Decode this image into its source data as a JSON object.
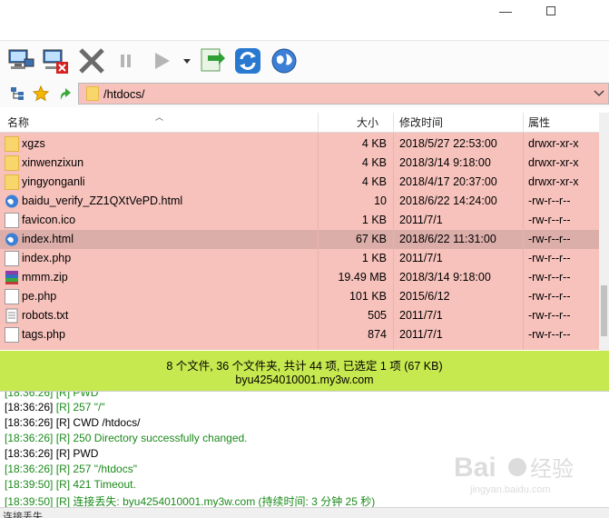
{
  "window": {
    "minimize": "—",
    "maximize": ""
  },
  "path": {
    "value": "/htdocs/"
  },
  "columns": {
    "name": "名称",
    "size": "大小",
    "modified": "修改时间",
    "attr": "属性"
  },
  "files": [
    {
      "name": "xgzs",
      "size": "4 KB",
      "modified": "2018/5/27 22:53:00",
      "attr": "drwxr-xr-x",
      "icon": "folder-icon"
    },
    {
      "name": "xinwenzixun",
      "size": "4 KB",
      "modified": "2018/3/14 9:18:00",
      "attr": "drwxr-xr-x",
      "icon": "folder-icon"
    },
    {
      "name": "yingyonganli",
      "size": "4 KB",
      "modified": "2018/4/17 20:37:00",
      "attr": "drwxr-xr-x",
      "icon": "folder-icon"
    },
    {
      "name": "baidu_verify_ZZ1QXtVePD.html",
      "size": "10",
      "modified": "2018/6/22 14:24:00",
      "attr": "-rw-r--r--",
      "icon": "html-file-icon"
    },
    {
      "name": "favicon.ico",
      "size": "1 KB",
      "modified": "2011/7/1",
      "attr": "-rw-r--r--",
      "icon": "file-icon"
    },
    {
      "name": "index.html",
      "size": "67 KB",
      "modified": "2018/6/22 11:31:00",
      "attr": "-rw-r--r--",
      "icon": "html-file-icon"
    },
    {
      "name": "index.php",
      "size": "1 KB",
      "modified": "2011/7/1",
      "attr": "-rw-r--r--",
      "icon": "file-icon"
    },
    {
      "name": "mmm.zip",
      "size": "19.49 MB",
      "modified": "2018/3/14 9:18:00",
      "attr": "-rw-r--r--",
      "icon": "zip-file-icon"
    },
    {
      "name": "pe.php",
      "size": "101 KB",
      "modified": "2015/6/12",
      "attr": "-rw-r--r--",
      "icon": "file-icon"
    },
    {
      "name": "robots.txt",
      "size": "505",
      "modified": "2011/7/1",
      "attr": "-rw-r--r--",
      "icon": "text-file-icon"
    },
    {
      "name": "tags.php",
      "size": "874",
      "modified": "2011/7/1",
      "attr": "-rw-r--r--",
      "icon": "file-icon"
    }
  ],
  "status": {
    "summary": "8 个文件, 36 个文件夹, 共计 44 项, 已选定 1 项 (67 KB)",
    "host": "byu4254010001.my3w.com"
  },
  "log": [
    {
      "time": "[18:36:26]",
      "tag": "[R]",
      "msg": "257 \"/\"",
      "color": "#1b8a1b"
    },
    {
      "time": "[18:36:26]",
      "tag": "[R]",
      "msg": "CWD /htdocs/",
      "color": "#000000"
    },
    {
      "time": "[18:36:26]",
      "tag": "[R]",
      "msg": "250 Directory successfully changed.",
      "color": "#1b8a1b"
    },
    {
      "time": "[18:36:26]",
      "tag": "[R]",
      "msg": "PWD",
      "color": "#000000"
    },
    {
      "time": "[18:36:26]",
      "tag": "[R]",
      "msg": "257 \"/htdocs\"",
      "color": "#1b8a1b"
    },
    {
      "time": "[18:39:50]",
      "tag": "[R]",
      "msg": "421 Timeout.",
      "color": "#1b8a1b"
    },
    {
      "time": "[18:39:50]",
      "tag": "[R]",
      "msg": "连接丢失: byu4254010001.my3w.com (持续时间: 3 分钟 25 秒)",
      "color": "#1b8a1b"
    }
  ],
  "bottom_status": "连接丢失",
  "colors": {
    "list_bg": "#f7c2bc",
    "selected_row": "#dcaea9",
    "status_bg": "#c6e94f",
    "log_green": "#1b8a1b"
  }
}
